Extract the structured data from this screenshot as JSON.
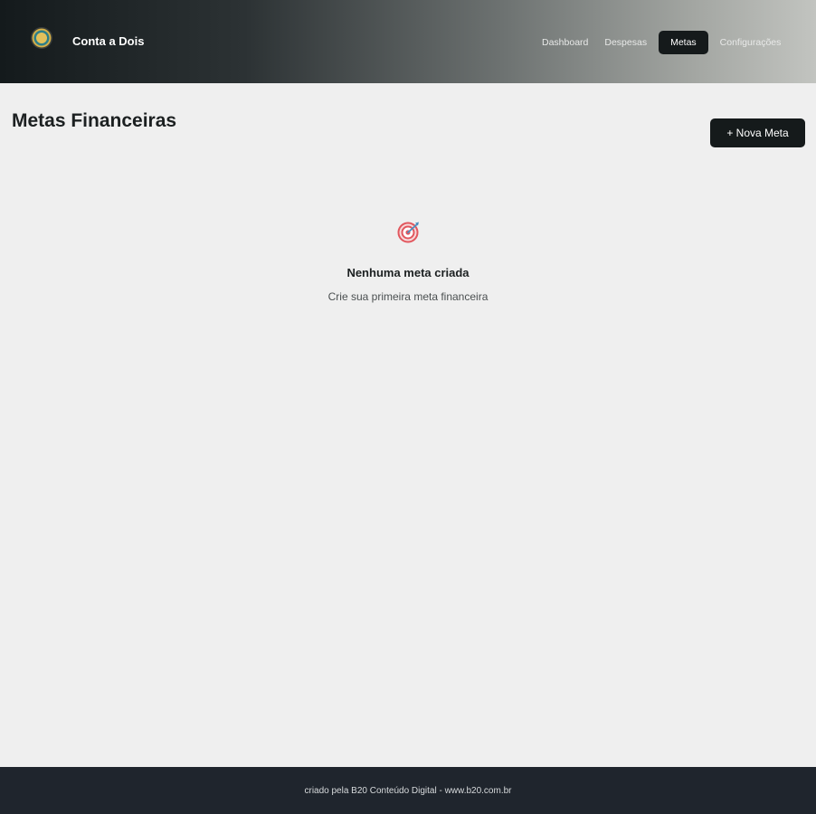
{
  "header": {
    "brand": "Conta a Dois",
    "logo_icon": "couple-coin-logo",
    "nav": [
      {
        "label": "Dashboard",
        "active": false
      },
      {
        "label": "Despesas",
        "active": false
      },
      {
        "label": "Metas",
        "active": true
      },
      {
        "label": "Configurações",
        "active": false
      }
    ]
  },
  "main": {
    "title": "Metas Financeiras",
    "new_button_label": "+ Nova Meta",
    "empty_state": {
      "icon": "target-icon",
      "title": "Nenhuma meta criada",
      "subtitle": "Crie sua primeira meta financeira"
    }
  },
  "footer": {
    "text": "criado pela B20 Conteúdo Digital - www.b20.com.br"
  },
  "colors": {
    "primary_dark": "#151a1b",
    "background": "#efefef",
    "footer_bg": "#1f252d",
    "target_red": "#e2575e",
    "target_dart": "#4a8fc0"
  }
}
